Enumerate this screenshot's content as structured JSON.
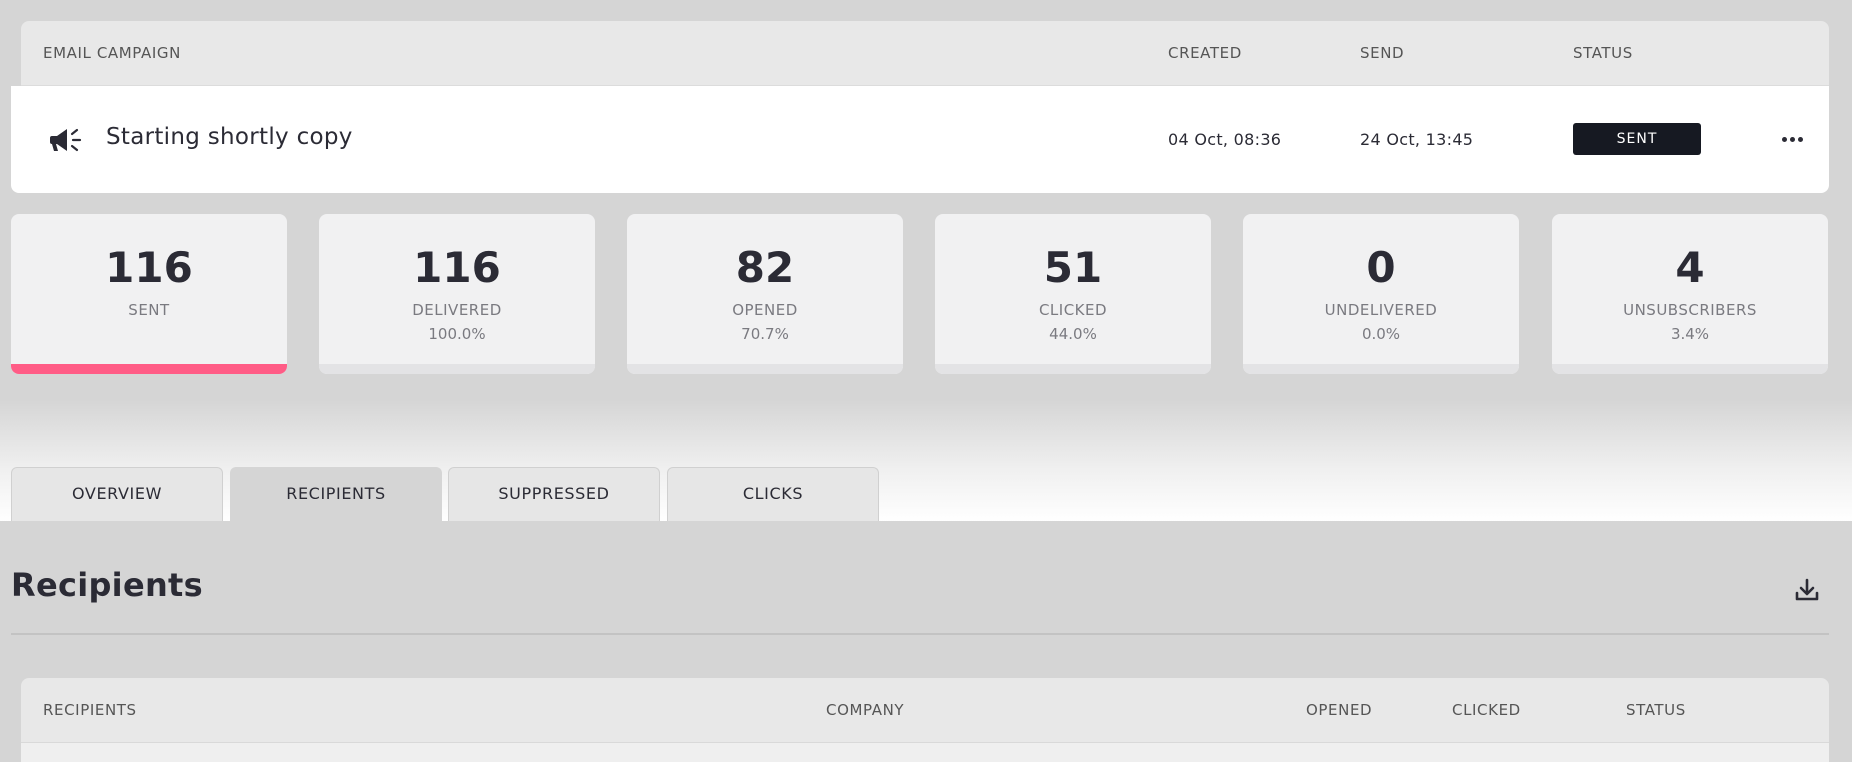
{
  "campaign_table": {
    "headers": {
      "email_campaign": "EMAIL CAMPAIGN",
      "created": "CREATED",
      "send": "SEND",
      "status": "STATUS"
    },
    "row": {
      "icon": "megaphone-icon",
      "name": "Starting shortly copy",
      "created": "04 Oct, 08:36",
      "send": "24 Oct, 13:45",
      "status": "SENT",
      "more_icon": "more-horizontal-icon"
    }
  },
  "stats": [
    {
      "value": "116",
      "label": "SENT",
      "percent": ""
    },
    {
      "value": "116",
      "label": "DELIVERED",
      "percent": "100.0%"
    },
    {
      "value": "82",
      "label": "OPENED",
      "percent": "70.7%"
    },
    {
      "value": "51",
      "label": "CLICKED",
      "percent": "44.0%"
    },
    {
      "value": "0",
      "label": "UNDELIVERED",
      "percent": "0.0%"
    },
    {
      "value": "4",
      "label": "UNSUBSCRIBERS",
      "percent": "3.4%"
    }
  ],
  "tabs": [
    {
      "label": "OVERVIEW"
    },
    {
      "label": "RECIPIENTS"
    },
    {
      "label": "SUPPRESSED"
    },
    {
      "label": "CLICKS"
    }
  ],
  "recipients": {
    "title": "Recipients",
    "download_icon": "download-icon",
    "headers": {
      "recipients": "RECIPIENTS",
      "company": "COMPANY",
      "opened": "OPENED",
      "clicked": "CLICKED",
      "status": "STATUS"
    }
  },
  "colors": {
    "accent": "#ff5c86",
    "badge": "#161922",
    "background": "#d5d5d5"
  }
}
